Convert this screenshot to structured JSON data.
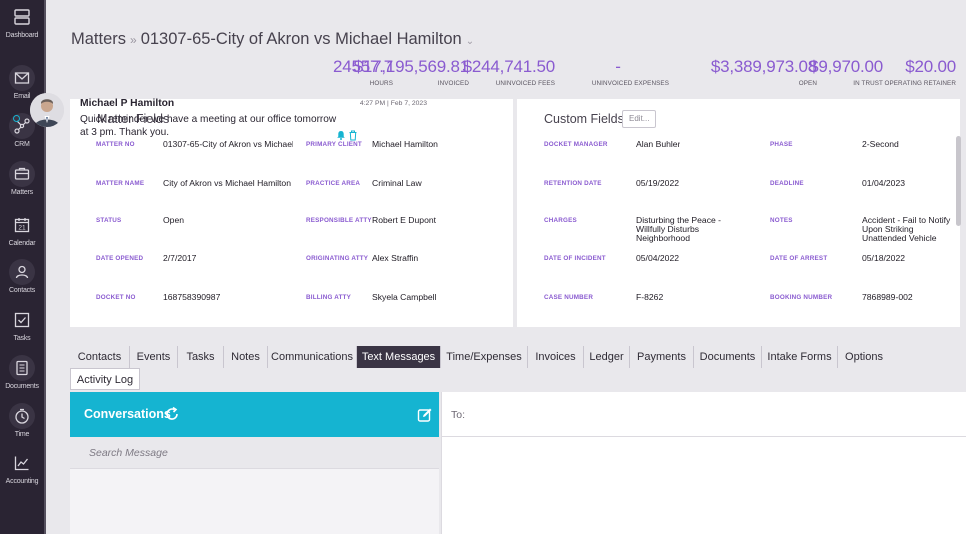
{
  "sidebar": {
    "items": [
      {
        "label": "Dashboard",
        "icon": "dashboard-icon"
      },
      {
        "label": "Email",
        "icon": "email-icon"
      },
      {
        "label": "CRM",
        "icon": "crm-icon"
      },
      {
        "label": "Matters",
        "icon": "matters-icon"
      },
      {
        "label": "Calendar",
        "icon": "calendar-icon",
        "day": "21"
      },
      {
        "label": "Contacts",
        "icon": "contacts-icon"
      },
      {
        "label": "Tasks",
        "icon": "tasks-icon"
      },
      {
        "label": "Documents",
        "icon": "documents-icon"
      },
      {
        "label": "Time",
        "icon": "time-icon"
      },
      {
        "label": "Accounting",
        "icon": "accounting-icon"
      }
    ]
  },
  "header": {
    "breadcrumb_root": "Matters",
    "breadcrumb_sep": "»",
    "matter_title": "01307-65-City of Akron vs Michael Hamilton",
    "stats": [
      {
        "value": "24557.7",
        "label": "HOURS"
      },
      {
        "value": "$17,195,569.81",
        "label": "INVOICED"
      },
      {
        "value": "$244,741.50",
        "label": "UNINVOICED FEES"
      },
      {
        "value": "-",
        "label": "UNINVOICED EXPENSES"
      },
      {
        "value": "$3,389,973.08",
        "label": "OPEN"
      },
      {
        "value": "$9,970.00",
        "label": "IN TRUST"
      },
      {
        "value": "$20.00",
        "label": "OPERATING RETAINER"
      }
    ]
  },
  "matter_fields": {
    "title": "Matter Fields",
    "rows": [
      {
        "l1": "MATTER NO",
        "v1": "01307-65-City of Akron vs Michael Hamilton",
        "l2": "PRIMARY CLIENT",
        "v2": "Michael Hamilton"
      },
      {
        "l1": "MATTER NAME",
        "v1": "City of Akron vs Michael Hamilton",
        "l2": "PRACTICE AREA",
        "v2": "Criminal Law"
      },
      {
        "l1": "STATUS",
        "v1": "Open",
        "l2": "RESPONSIBLE ATTY",
        "v2": "Robert E Dupont"
      },
      {
        "l1": "DATE OPENED",
        "v1": "2/7/2017",
        "l2": "ORIGINATING ATTY",
        "v2": "Alex Straffin"
      },
      {
        "l1": "DOCKET NO",
        "v1": "168758390987",
        "l2": "BILLING ATTY",
        "v2": "Skyela Campbell"
      }
    ]
  },
  "custom_fields": {
    "title": "Custom Fields",
    "edit_label": "Edit...",
    "rows": [
      {
        "l1": "DOCKET MANAGER",
        "v1": "Alan Buhler",
        "l2": "PHASE",
        "v2": "2-Second"
      },
      {
        "l1": "RETENTION DATE",
        "v1": "05/19/2022",
        "l2": "DEADLINE",
        "v2": "01/04/2023"
      },
      {
        "l1": "CHARGES",
        "v1": "Disturbing the Peace - Willfully Disturbs Neighborhood",
        "l2": "NOTES",
        "v2": "Accident - Fail to Notify Upon Striking Unattended Vehicle"
      },
      {
        "l1": "DATE OF INCIDENT",
        "v1": "05/04/2022",
        "l2": "DATE OF ARREST",
        "v2": "05/18/2022"
      },
      {
        "l1": "CASE NUMBER",
        "v1": "F-8262",
        "l2": "BOOKING NUMBER",
        "v2": "7868989-002"
      }
    ]
  },
  "tabs": {
    "row1": [
      "Contacts",
      "Events",
      "Tasks",
      "Notes",
      "Communications",
      "Text Messages",
      "Time/Expenses",
      "Invoices",
      "Ledger",
      "Payments",
      "Documents",
      "Intake Forms",
      "Options"
    ],
    "row2": [
      "Activity Log"
    ],
    "active": "Text Messages"
  },
  "conversations": {
    "title": "Conversations",
    "search_placeholder": "Search Message",
    "items": [
      {
        "name": "Michael P Hamilton",
        "time": "4:27 PM | Feb 7, 2023",
        "message": "Quick reminder we have a meeting at our office tomorrow at 3 pm. Thank you."
      }
    ]
  },
  "compose": {
    "to_label": "To:"
  },
  "colors": {
    "accent": "#8a5bd0",
    "conversation_header": "#15b4d1",
    "sidebar": "#2a2433",
    "active_tab": "#3a3444"
  }
}
